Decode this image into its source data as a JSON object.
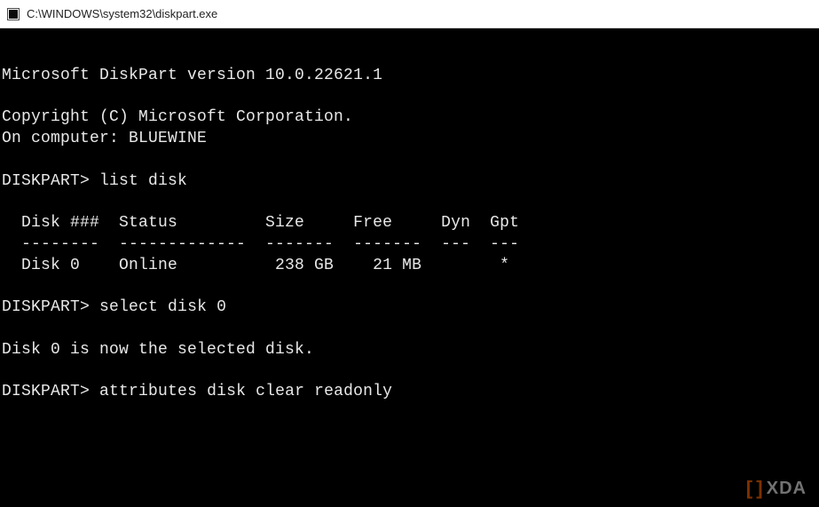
{
  "window": {
    "title": "C:\\WINDOWS\\system32\\diskpart.exe"
  },
  "terminal": {
    "version_line": "Microsoft DiskPart version 10.0.22621.1",
    "copyright_line": "Copyright (C) Microsoft Corporation.",
    "computer_line": "On computer: BLUEWINE",
    "prompt": "DISKPART>",
    "cmd1": "list disk",
    "table": {
      "header": "  Disk ###  Status         Size     Free     Dyn  Gpt",
      "divider": "  --------  -------------  -------  -------  ---  ---",
      "rows": [
        "  Disk 0    Online          238 GB    21 MB        *"
      ]
    },
    "cmd2": "select disk 0",
    "response2": "Disk 0 is now the selected disk.",
    "cmd3": "attributes disk clear readonly"
  },
  "watermark": {
    "text": "XDA"
  }
}
